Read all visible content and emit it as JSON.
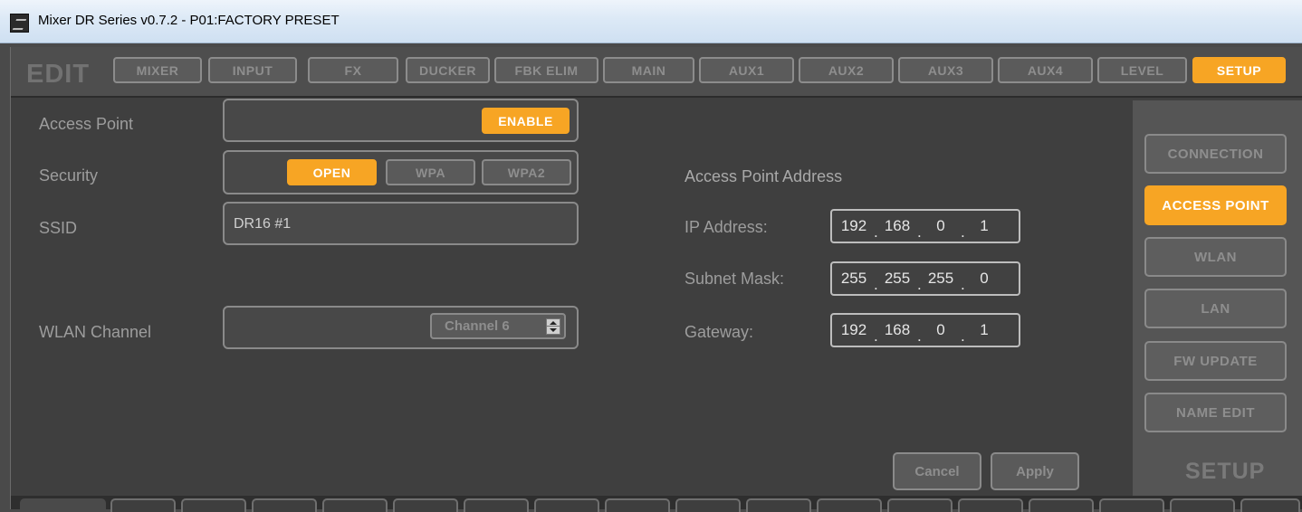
{
  "window": {
    "title": "Mixer DR Series v0.7.2 - P01:FACTORY PRESET"
  },
  "nav": {
    "edit_label": "EDIT",
    "tabs": [
      {
        "label": "MIXER",
        "active": false
      },
      {
        "label": "INPUT",
        "active": false
      },
      {
        "label": "FX",
        "active": false
      },
      {
        "label": "DUCKER",
        "active": false
      },
      {
        "label": "FBK ELIM",
        "active": false
      },
      {
        "label": "MAIN",
        "active": false
      },
      {
        "label": "AUX1",
        "active": false
      },
      {
        "label": "AUX2",
        "active": false
      },
      {
        "label": "AUX3",
        "active": false
      },
      {
        "label": "AUX4",
        "active": false
      },
      {
        "label": "LEVEL",
        "active": false
      },
      {
        "label": "SETUP",
        "active": true
      }
    ]
  },
  "access_point": {
    "label": "Access Point",
    "enable_label": "ENABLE",
    "security_label": "Security",
    "security_options": [
      {
        "label": "OPEN",
        "selected": true
      },
      {
        "label": "WPA",
        "selected": false
      },
      {
        "label": "WPA2",
        "selected": false
      }
    ],
    "ssid_label": "SSID",
    "ssid_value": "DR16 #1",
    "channel_label": "WLAN Channel",
    "channel_value": "Channel 6"
  },
  "address": {
    "heading": "Access Point Address",
    "ip_label": "IP Address:",
    "ip": [
      "192",
      "168",
      "0",
      "1"
    ],
    "subnet_label": "Subnet Mask:",
    "subnet": [
      "255",
      "255",
      "255",
      "0"
    ],
    "gateway_label": "Gateway:",
    "gateway": [
      "192",
      "168",
      "0",
      "1"
    ]
  },
  "actions": {
    "cancel": "Cancel",
    "apply": "Apply"
  },
  "setup_menu": {
    "items": [
      {
        "label": "CONNECTION",
        "active": false
      },
      {
        "label": "ACCESS POINT",
        "active": true
      },
      {
        "label": "WLAN",
        "active": false
      },
      {
        "label": "LAN",
        "active": false
      },
      {
        "label": "FW UPDATE",
        "active": false
      },
      {
        "label": "NAME EDIT",
        "active": false
      }
    ],
    "panel_label": "SETUP"
  },
  "colors": {
    "accent": "#f7a524",
    "background": "#3f3f3f",
    "panel": "#555555"
  }
}
